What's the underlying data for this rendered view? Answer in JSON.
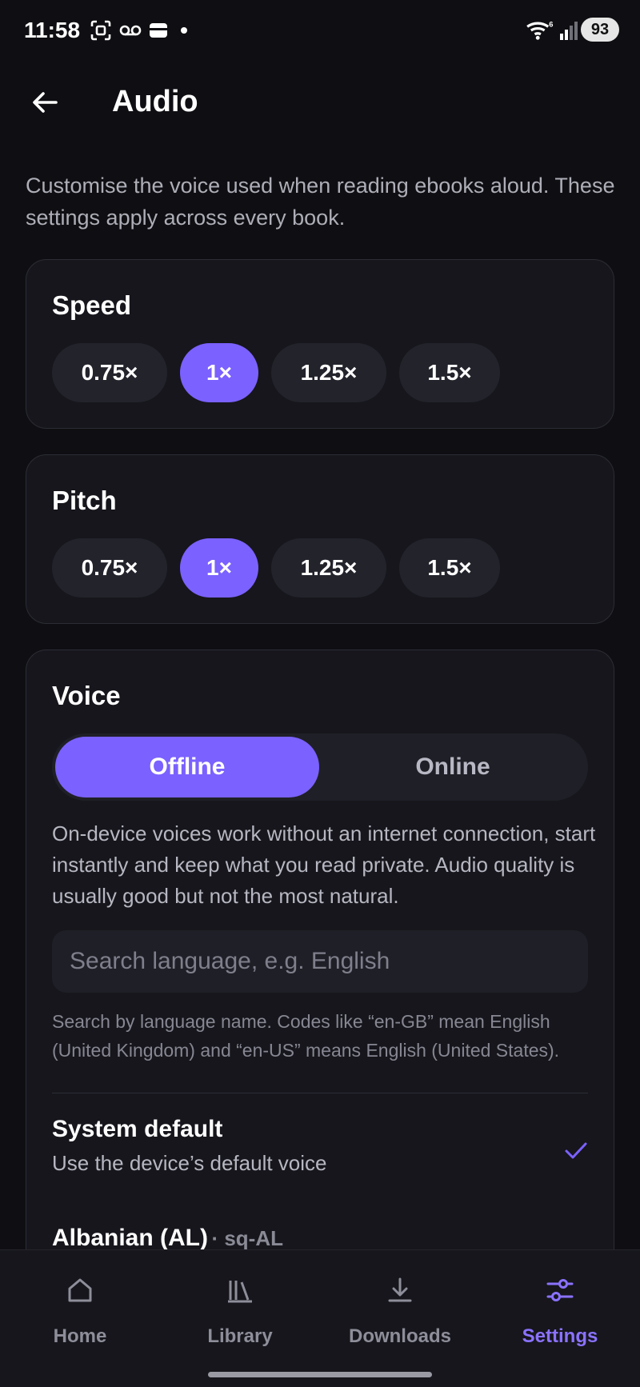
{
  "status_bar": {
    "time": "11:58",
    "battery": "93"
  },
  "header": {
    "title": "Audio"
  },
  "intro": "Customise the voice used when reading ebooks aloud. These settings apply across every book.",
  "speed": {
    "title": "Speed",
    "options": [
      "0.75×",
      "1×",
      "1.25×",
      "1.5×"
    ],
    "selected": "1×"
  },
  "pitch": {
    "title": "Pitch",
    "options": [
      "0.75×",
      "1×",
      "1.25×",
      "1.5×"
    ],
    "selected": "1×"
  },
  "voice": {
    "title": "Voice",
    "modes": [
      "Offline",
      "Online"
    ],
    "selected_mode": "Offline",
    "description": "On-device voices work without an internet connection, start instantly and keep what you read private. Audio quality is usually good but not the most natural.",
    "search_placeholder": "Search language, e.g. English",
    "search_value": "",
    "search_help": "Search by language name. Codes like “en-GB” mean English (United Kingdom) and “en-US” means English (United States).",
    "items": [
      {
        "name": "System default",
        "subtitle": "Use the device’s default voice",
        "selected": true
      },
      {
        "name": "Albanian (AL)",
        "code": "· sq-AL",
        "selected": false
      }
    ]
  },
  "nav": {
    "items": [
      {
        "label": "Home",
        "icon": "home-icon"
      },
      {
        "label": "Library",
        "icon": "library-icon"
      },
      {
        "label": "Downloads",
        "icon": "download-icon"
      },
      {
        "label": "Settings",
        "icon": "settings-sliders-icon"
      }
    ],
    "active": "Settings"
  },
  "colors": {
    "accent": "#7b61ff",
    "background": "#0f0f13",
    "card": "#16161c"
  }
}
